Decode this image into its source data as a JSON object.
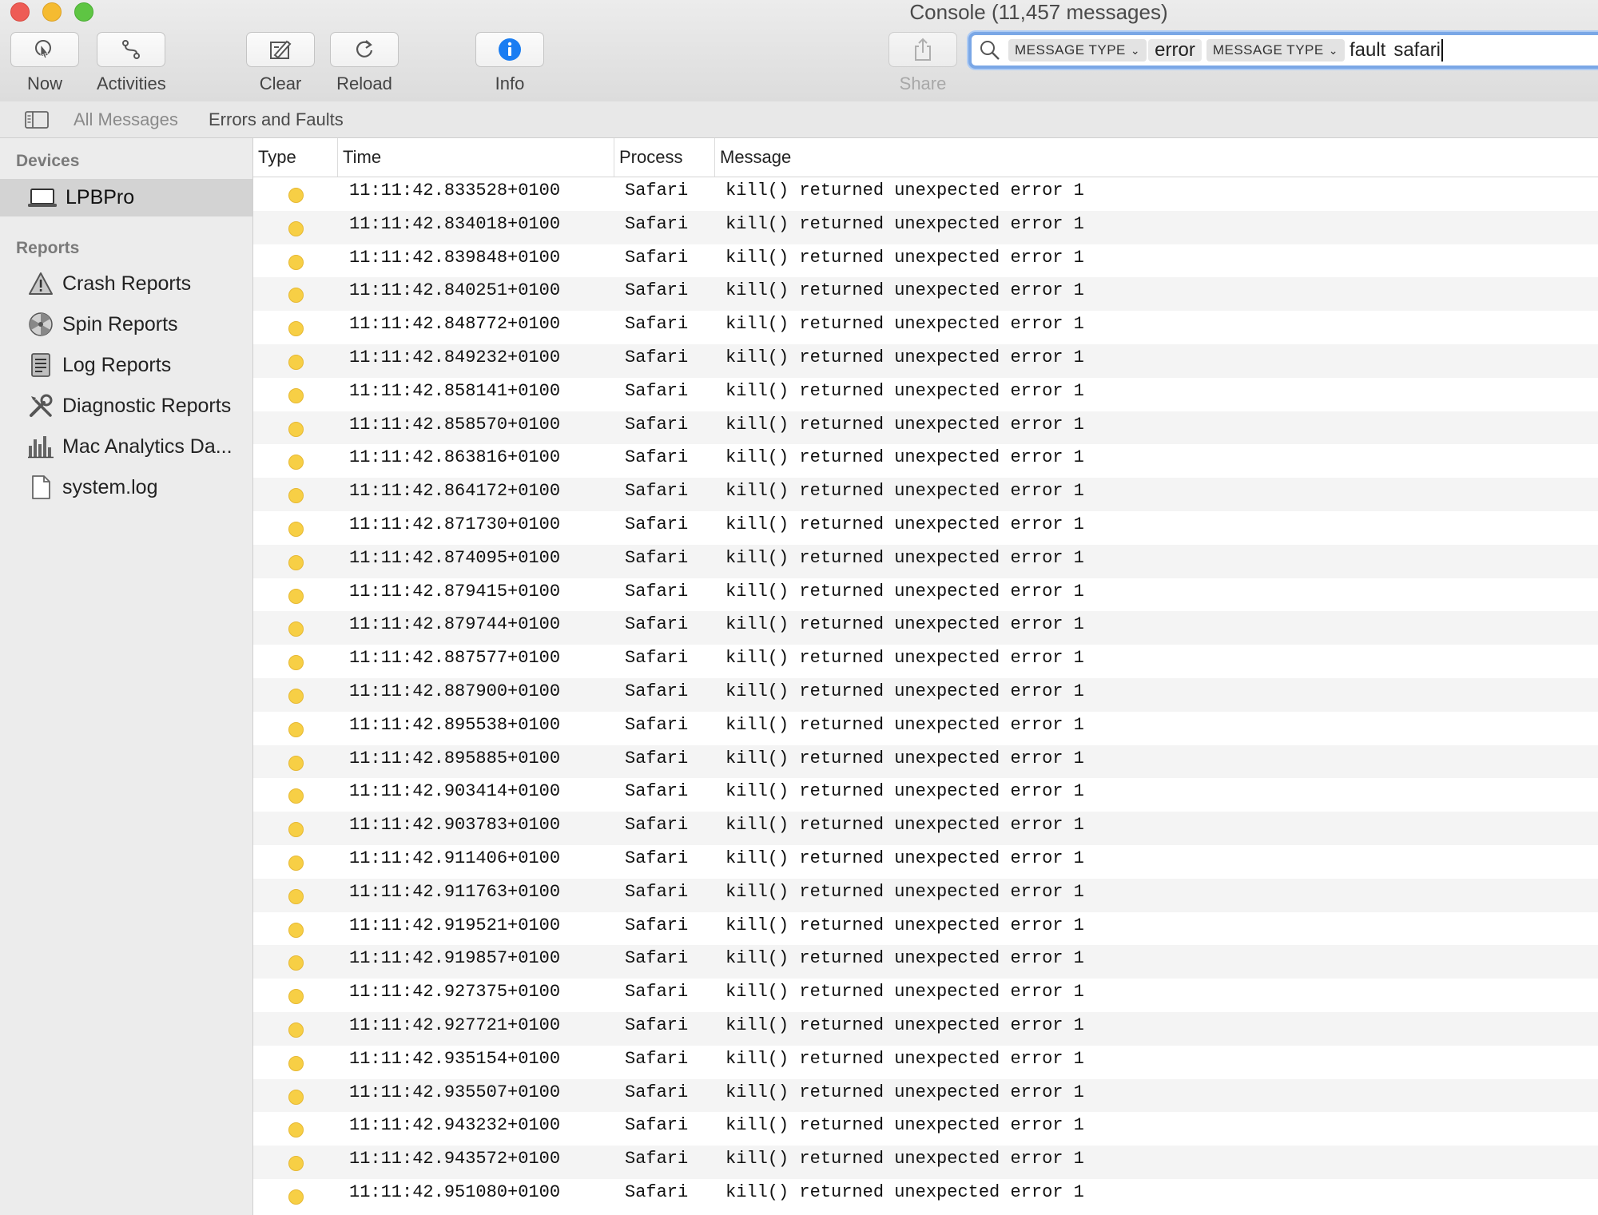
{
  "window": {
    "title": "Console (11,457 messages)"
  },
  "toolbar": {
    "now_label": "Now",
    "activities_label": "Activities",
    "clear_label": "Clear",
    "reload_label": "Reload",
    "info_label": "Info",
    "share_label": "Share"
  },
  "search": {
    "token1_type": "MESSAGE TYPE",
    "token1_value": "error",
    "token2_type": "MESSAGE TYPE",
    "token2_value": "fault",
    "text": "safari"
  },
  "filters": {
    "all_messages": "All Messages",
    "errors_and_faults": "Errors and Faults"
  },
  "sidebar": {
    "devices_header": "Devices",
    "device": "LPBPro",
    "reports_header": "Reports",
    "reports": [
      {
        "label": "Crash Reports",
        "icon": "warning-icon"
      },
      {
        "label": "Spin Reports",
        "icon": "spinner-icon"
      },
      {
        "label": "Log Reports",
        "icon": "log-document-icon"
      },
      {
        "label": "Diagnostic Reports",
        "icon": "tools-icon"
      },
      {
        "label": "Mac Analytics Da...",
        "icon": "bar-chart-icon"
      },
      {
        "label": "system.log",
        "icon": "file-icon"
      }
    ]
  },
  "table": {
    "columns": {
      "type": "Type",
      "time": "Time",
      "process": "Process",
      "message": "Message"
    },
    "type_color": "#f7cf45",
    "rows": [
      {
        "time": "11:11:42.833528+0100",
        "process": "Safari",
        "message": "kill() returned unexpected error 1"
      },
      {
        "time": "11:11:42.834018+0100",
        "process": "Safari",
        "message": "kill() returned unexpected error 1"
      },
      {
        "time": "11:11:42.839848+0100",
        "process": "Safari",
        "message": "kill() returned unexpected error 1"
      },
      {
        "time": "11:11:42.840251+0100",
        "process": "Safari",
        "message": "kill() returned unexpected error 1"
      },
      {
        "time": "11:11:42.848772+0100",
        "process": "Safari",
        "message": "kill() returned unexpected error 1"
      },
      {
        "time": "11:11:42.849232+0100",
        "process": "Safari",
        "message": "kill() returned unexpected error 1"
      },
      {
        "time": "11:11:42.858141+0100",
        "process": "Safari",
        "message": "kill() returned unexpected error 1"
      },
      {
        "time": "11:11:42.858570+0100",
        "process": "Safari",
        "message": "kill() returned unexpected error 1"
      },
      {
        "time": "11:11:42.863816+0100",
        "process": "Safari",
        "message": "kill() returned unexpected error 1"
      },
      {
        "time": "11:11:42.864172+0100",
        "process": "Safari",
        "message": "kill() returned unexpected error 1"
      },
      {
        "time": "11:11:42.871730+0100",
        "process": "Safari",
        "message": "kill() returned unexpected error 1"
      },
      {
        "time": "11:11:42.874095+0100",
        "process": "Safari",
        "message": "kill() returned unexpected error 1"
      },
      {
        "time": "11:11:42.879415+0100",
        "process": "Safari",
        "message": "kill() returned unexpected error 1"
      },
      {
        "time": "11:11:42.879744+0100",
        "process": "Safari",
        "message": "kill() returned unexpected error 1"
      },
      {
        "time": "11:11:42.887577+0100",
        "process": "Safari",
        "message": "kill() returned unexpected error 1"
      },
      {
        "time": "11:11:42.887900+0100",
        "process": "Safari",
        "message": "kill() returned unexpected error 1"
      },
      {
        "time": "11:11:42.895538+0100",
        "process": "Safari",
        "message": "kill() returned unexpected error 1"
      },
      {
        "time": "11:11:42.895885+0100",
        "process": "Safari",
        "message": "kill() returned unexpected error 1"
      },
      {
        "time": "11:11:42.903414+0100",
        "process": "Safari",
        "message": "kill() returned unexpected error 1"
      },
      {
        "time": "11:11:42.903783+0100",
        "process": "Safari",
        "message": "kill() returned unexpected error 1"
      },
      {
        "time": "11:11:42.911406+0100",
        "process": "Safari",
        "message": "kill() returned unexpected error 1"
      },
      {
        "time": "11:11:42.911763+0100",
        "process": "Safari",
        "message": "kill() returned unexpected error 1"
      },
      {
        "time": "11:11:42.919521+0100",
        "process": "Safari",
        "message": "kill() returned unexpected error 1"
      },
      {
        "time": "11:11:42.919857+0100",
        "process": "Safari",
        "message": "kill() returned unexpected error 1"
      },
      {
        "time": "11:11:42.927375+0100",
        "process": "Safari",
        "message": "kill() returned unexpected error 1"
      },
      {
        "time": "11:11:42.927721+0100",
        "process": "Safari",
        "message": "kill() returned unexpected error 1"
      },
      {
        "time": "11:11:42.935154+0100",
        "process": "Safari",
        "message": "kill() returned unexpected error 1"
      },
      {
        "time": "11:11:42.935507+0100",
        "process": "Safari",
        "message": "kill() returned unexpected error 1"
      },
      {
        "time": "11:11:42.943232+0100",
        "process": "Safari",
        "message": "kill() returned unexpected error 1"
      },
      {
        "time": "11:11:42.943572+0100",
        "process": "Safari",
        "message": "kill() returned unexpected error 1"
      },
      {
        "time": "11:11:42.951080+0100",
        "process": "Safari",
        "message": "kill() returned unexpected error 1"
      }
    ]
  }
}
